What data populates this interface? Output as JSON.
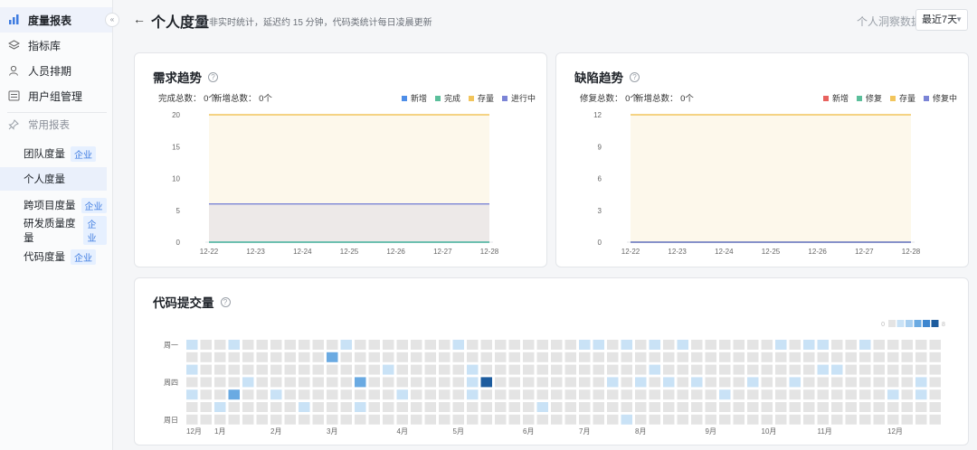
{
  "sidebar": {
    "items": [
      {
        "label": "度量报表",
        "active": true
      },
      {
        "label": "指标库"
      },
      {
        "label": "人员排期"
      },
      {
        "label": "用户组管理"
      }
    ],
    "section_label": "常用报表",
    "sub_items": [
      {
        "label": "团队度量",
        "tag": "企业"
      },
      {
        "label": "个人度量",
        "active": true
      },
      {
        "label": "跨项目度量",
        "tag": "企业"
      },
      {
        "label": "研发质量度量",
        "tag": "企业"
      },
      {
        "label": "代码度量",
        "tag": "企业"
      }
    ],
    "collapse_glyph": "«"
  },
  "header": {
    "back_glyph": "←",
    "title": "个人度量",
    "note": "非实时统计，延迟约 15 分钟，代码类统计每日凌晨更新",
    "insight_label": "个人洞察数据",
    "range_value": "最近7天"
  },
  "demand": {
    "title": "需求趋势",
    "done_total": "完成总数：  0个",
    "new_total": "新增总数：  0个",
    "legend": [
      {
        "label": "新增",
        "color": "#4e8ee8"
      },
      {
        "label": "完成",
        "color": "#5bbf9b"
      },
      {
        "label": "存量",
        "color": "#f2c55c"
      },
      {
        "label": "进行中",
        "color": "#7b84d6"
      }
    ]
  },
  "defect": {
    "title": "缺陷趋势",
    "fix_total": "修复总数：  0个",
    "new_total": "新增总数：  0个",
    "legend": [
      {
        "label": "新增",
        "color": "#e8625e"
      },
      {
        "label": "修复",
        "color": "#5bbf9b"
      },
      {
        "label": "存量",
        "color": "#f2c55c"
      },
      {
        "label": "修复中",
        "color": "#7b84d6"
      }
    ]
  },
  "code": {
    "title": "代码提交量",
    "weekday_labels": [
      "周一",
      "周四",
      "周日"
    ],
    "month_labels": [
      "12月",
      "1月",
      "2月",
      "3月",
      "4月",
      "5月",
      "6月",
      "7月",
      "8月",
      "9月",
      "10月",
      "11月",
      "12月"
    ],
    "scale_less": "0",
    "scale_more": "8",
    "scale_colors": [
      "#e4e4e4",
      "#c9e2f6",
      "#a8cff0",
      "#6aaae2",
      "#3d86cf",
      "#1d5c9e"
    ]
  },
  "chart_data": [
    {
      "type": "area",
      "title": "需求趋势",
      "categories": [
        "12-22",
        "12-23",
        "12-24",
        "12-25",
        "12-26",
        "12-27",
        "12-28"
      ],
      "ylim": [
        0,
        20
      ],
      "yticks": [
        0,
        5,
        10,
        15,
        20
      ],
      "series": [
        {
          "name": "新增",
          "values": [
            0,
            0,
            0,
            0,
            0,
            0,
            0
          ],
          "color": "#4e8ee8"
        },
        {
          "name": "完成",
          "values": [
            0,
            0,
            0,
            0,
            0,
            0,
            0
          ],
          "color": "#5bbf9b"
        },
        {
          "name": "存量",
          "values": [
            20,
            20,
            20,
            20,
            20,
            20,
            20
          ],
          "color": "#f2c55c"
        },
        {
          "name": "进行中",
          "values": [
            6,
            6,
            6,
            6,
            6,
            6,
            6
          ],
          "color": "#7b84d6"
        }
      ]
    },
    {
      "type": "area",
      "title": "缺陷趋势",
      "categories": [
        "12-22",
        "12-23",
        "12-24",
        "12-25",
        "12-26",
        "12-27",
        "12-28"
      ],
      "ylim": [
        0,
        12
      ],
      "yticks": [
        0,
        3,
        6,
        9,
        12
      ],
      "series": [
        {
          "name": "新增",
          "values": [
            0,
            0,
            0,
            0,
            0,
            0,
            0
          ],
          "color": "#e8625e"
        },
        {
          "name": "修复",
          "values": [
            0,
            0,
            0,
            0,
            0,
            0,
            0
          ],
          "color": "#5bbf9b"
        },
        {
          "name": "存量",
          "values": [
            12,
            12,
            12,
            12,
            12,
            12,
            12
          ],
          "color": "#f2c55c"
        },
        {
          "name": "修复中",
          "values": [
            0,
            0,
            0,
            0,
            0,
            0,
            0
          ],
          "color": "#7b84d6"
        }
      ]
    },
    {
      "type": "heatmap",
      "title": "代码提交量",
      "weeks": 54,
      "days": 7,
      "levels": [
        {
          "week": 0,
          "day": 0,
          "level": 1
        },
        {
          "week": 0,
          "day": 2,
          "level": 1
        },
        {
          "week": 0,
          "day": 4,
          "level": 1
        },
        {
          "week": 2,
          "day": 5,
          "level": 1
        },
        {
          "week": 3,
          "day": 0,
          "level": 1
        },
        {
          "week": 3,
          "day": 4,
          "level": 3
        },
        {
          "week": 4,
          "day": 3,
          "level": 1
        },
        {
          "week": 6,
          "day": 4,
          "level": 1
        },
        {
          "week": 8,
          "day": 5,
          "level": 1
        },
        {
          "week": 10,
          "day": 1,
          "level": 3
        },
        {
          "week": 11,
          "day": 0,
          "level": 1
        },
        {
          "week": 12,
          "day": 3,
          "level": 3
        },
        {
          "week": 12,
          "day": 5,
          "level": 1
        },
        {
          "week": 14,
          "day": 2,
          "level": 1
        },
        {
          "week": 15,
          "day": 4,
          "level": 1
        },
        {
          "week": 19,
          "day": 0,
          "level": 1
        },
        {
          "week": 20,
          "day": 2,
          "level": 1
        },
        {
          "week": 20,
          "day": 3,
          "level": 1
        },
        {
          "week": 20,
          "day": 4,
          "level": 1
        },
        {
          "week": 21,
          "day": 3,
          "level": 5
        },
        {
          "week": 25,
          "day": 5,
          "level": 1
        },
        {
          "week": 28,
          "day": 0,
          "level": 1
        },
        {
          "week": 29,
          "day": 0,
          "level": 1
        },
        {
          "week": 30,
          "day": 3,
          "level": 1
        },
        {
          "week": 31,
          "day": 0,
          "level": 1
        },
        {
          "week": 31,
          "day": 6,
          "level": 1
        },
        {
          "week": 32,
          "day": 3,
          "level": 1
        },
        {
          "week": 33,
          "day": 0,
          "level": 1
        },
        {
          "week": 33,
          "day": 2,
          "level": 1
        },
        {
          "week": 34,
          "day": 3,
          "level": 1
        },
        {
          "week": 35,
          "day": 0,
          "level": 1
        },
        {
          "week": 36,
          "day": 3,
          "level": 1
        },
        {
          "week": 38,
          "day": 4,
          "level": 1
        },
        {
          "week": 40,
          "day": 3,
          "level": 1
        },
        {
          "week": 42,
          "day": 0,
          "level": 1
        },
        {
          "week": 43,
          "day": 3,
          "level": 1
        },
        {
          "week": 44,
          "day": 0,
          "level": 1
        },
        {
          "week": 45,
          "day": 0,
          "level": 1
        },
        {
          "week": 45,
          "day": 2,
          "level": 1
        },
        {
          "week": 46,
          "day": 2,
          "level": 1
        },
        {
          "week": 48,
          "day": 0,
          "level": 1
        },
        {
          "week": 50,
          "day": 4,
          "level": 1
        },
        {
          "week": 52,
          "day": 3,
          "level": 1
        },
        {
          "week": 52,
          "day": 4,
          "level": 1
        }
      ]
    }
  ]
}
